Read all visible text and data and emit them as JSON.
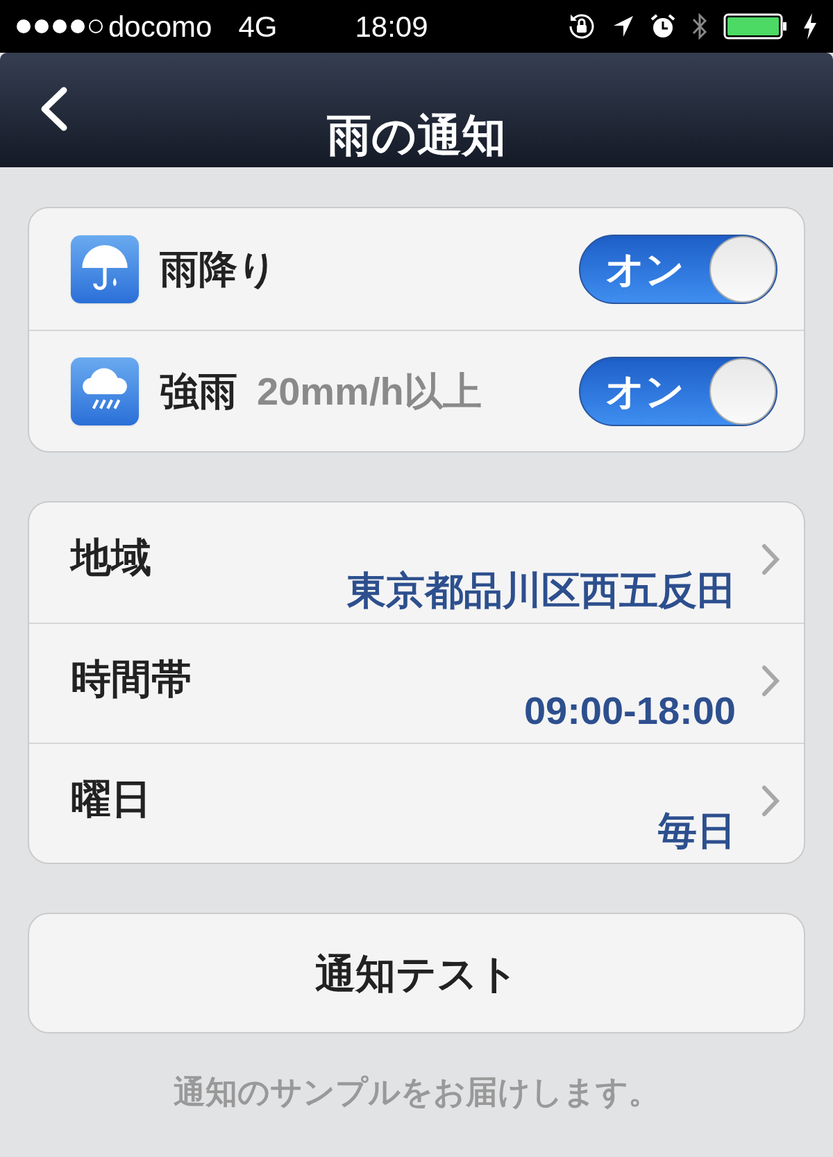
{
  "status_bar": {
    "carrier": "docomo",
    "network": "4G",
    "time": "18:09"
  },
  "nav": {
    "title": "雨の通知"
  },
  "toggles": [
    {
      "kind": "umbrella",
      "label": "雨降り",
      "on": true,
      "switch_text": "オン"
    },
    {
      "kind": "rain-cloud",
      "label": "強雨",
      "note": "20mm/h以上",
      "on": true,
      "switch_text": "オン"
    }
  ],
  "settings": [
    {
      "label": "地域",
      "value": "東京都品川区西五反田"
    },
    {
      "label": "時間帯",
      "value": "09:00-18:00"
    },
    {
      "label": "曜日",
      "value": "毎日"
    }
  ],
  "test_button": "通知テスト",
  "caption": "通知のサンプルをお届けします。"
}
